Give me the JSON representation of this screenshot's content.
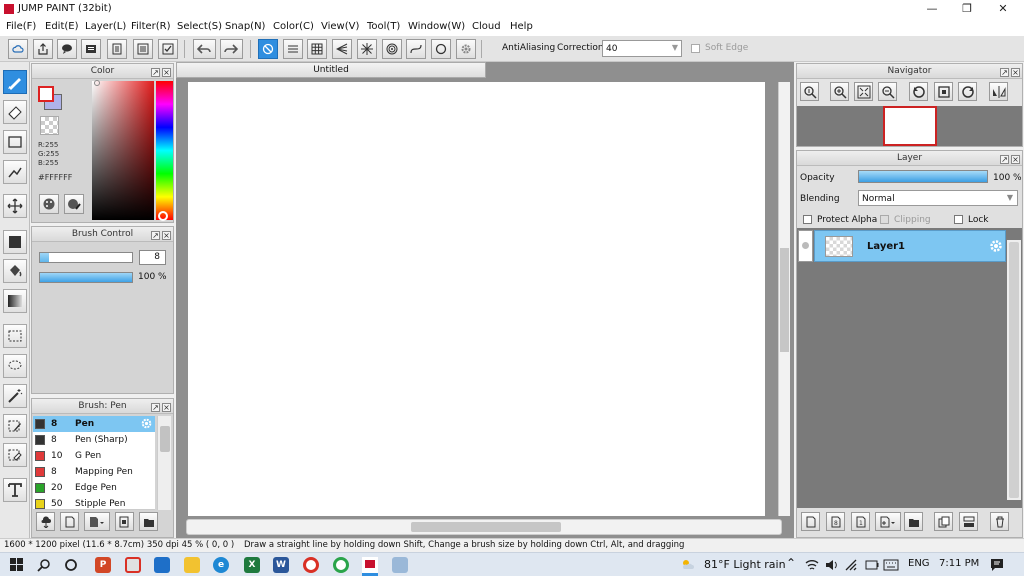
{
  "window": {
    "title": "JUMP PAINT (32bit)"
  },
  "menu": [
    "File(F)",
    "Edit(E)",
    "Layer(L)",
    "Filter(R)",
    "Select(S)",
    "Snap(N)",
    "Color(C)",
    "View(V)",
    "Tool(T)",
    "Window(W)",
    "Cloud",
    "Help"
  ],
  "toolbar": {
    "antialiasing_label": "AntiAliasing",
    "correction_label": "Correction",
    "correction_value": "40",
    "soft_edge_label": "Soft Edge"
  },
  "color_panel": {
    "title": "Color",
    "r": "R:255",
    "g": "G:255",
    "b": "B:255",
    "hex": "#FFFFFF"
  },
  "brush_control": {
    "title": "Brush Control",
    "size": "8",
    "opacity": "100 %",
    "opacity_fraction": 1.0,
    "size_fraction": 0.1
  },
  "brush_list": {
    "title": "Brush: Pen",
    "items": [
      {
        "size": "8",
        "name": "Pen",
        "color": "#333333"
      },
      {
        "size": "8",
        "name": "Pen (Sharp)",
        "color": "#333333"
      },
      {
        "size": "10",
        "name": "G Pen",
        "color": "#e03a3a"
      },
      {
        "size": "8",
        "name": "Mapping Pen",
        "color": "#e03a3a"
      },
      {
        "size": "20",
        "name": "Edge Pen",
        "color": "#2aa42a"
      },
      {
        "size": "50",
        "name": "Stipple Pen",
        "color": "#e8d21a"
      }
    ]
  },
  "canvas": {
    "tab": "Untitled"
  },
  "navigator": {
    "title": "Navigator"
  },
  "layer_panel": {
    "title": "Layer",
    "opacity_label": "Opacity",
    "opacity_value": "100 %",
    "opacity_fraction": 1.0,
    "blending_label": "Blending",
    "blending_value": "Normal",
    "protect_alpha": "Protect Alpha",
    "clipping": "Clipping",
    "lock": "Lock",
    "layers": [
      {
        "name": "Layer1"
      }
    ]
  },
  "statusbar": {
    "size": "1600 * 1200 pixel   (11.6 * 8.7cm)   350 dpi   45 %   ( 0, 0 )",
    "hint": "Draw a straight line by holding down Shift, Change a brush size by holding down Ctrl, Alt, and dragging"
  },
  "taskbar": {
    "weather": "81°F  Light rain",
    "lang": "ENG",
    "time": "7:11 PM"
  },
  "colors": {
    "accent": "#2f8ee0",
    "selection": "#7dc6f2",
    "canvas_bg": "#8f8f8f"
  }
}
